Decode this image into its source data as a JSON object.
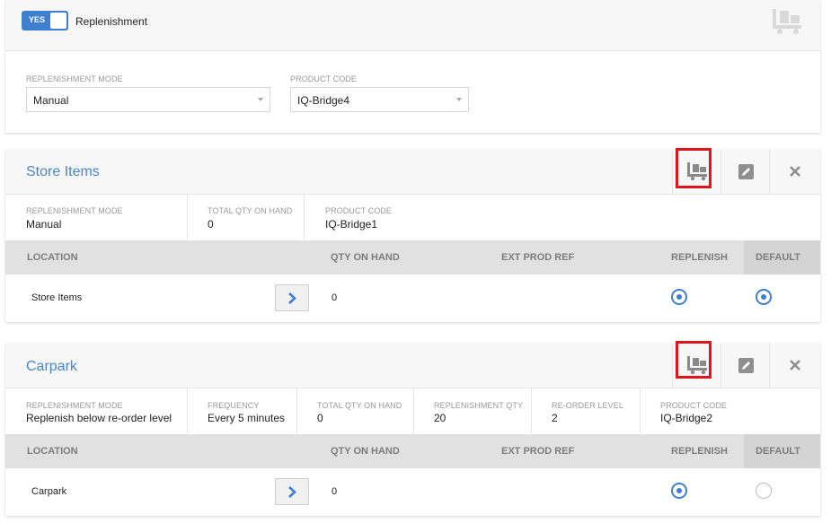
{
  "top": {
    "toggle_label": "YES",
    "toggle_caption": "Replenishment",
    "icon": "trolley-icon",
    "mode_label": "REPLENISHMENT MODE",
    "mode_value": "Manual",
    "code_label": "PRODUCT CODE",
    "code_value": "IQ-Bridge4"
  },
  "cards": [
    {
      "title": "Store Items",
      "fields": [
        {
          "label": "REPLENISHMENT MODE",
          "value": "Manual"
        },
        {
          "label": "TOTAL QTY ON HAND",
          "value": "0"
        },
        {
          "label": "PRODUCT CODE",
          "value": "IQ-Bridge1"
        }
      ],
      "columns": [
        "LOCATION",
        "QTY ON HAND",
        "EXT PROD REF",
        "REPLENISH",
        "DEFAULT"
      ],
      "row": {
        "location": "Store Items",
        "qty": "0",
        "replenish": true,
        "default": true
      }
    },
    {
      "title": "Carpark",
      "fields": [
        {
          "label": "REPLENISHMENT MODE",
          "value": "Replenish below re-order level"
        },
        {
          "label": "FREQUENCY",
          "value": "Every 5 minutes"
        },
        {
          "label": "TOTAL QTY ON HAND",
          "value": "0"
        },
        {
          "label": "REPLENISHMENT QTY",
          "value": "20"
        },
        {
          "label": "RE-ORDER LEVEL",
          "value": "2"
        },
        {
          "label": "PRODUCT CODE",
          "value": "IQ-Bridge2"
        }
      ],
      "columns": [
        "LOCATION",
        "QTY ON HAND",
        "EXT PROD REF",
        "REPLENISH",
        "DEFAULT"
      ],
      "row": {
        "location": "Carpark",
        "qty": "0",
        "replenish": true,
        "default": false
      }
    }
  ],
  "colors": {
    "accent": "#4a86c8",
    "highlight": "#e0141c",
    "toggle": "#3f7fd0"
  }
}
